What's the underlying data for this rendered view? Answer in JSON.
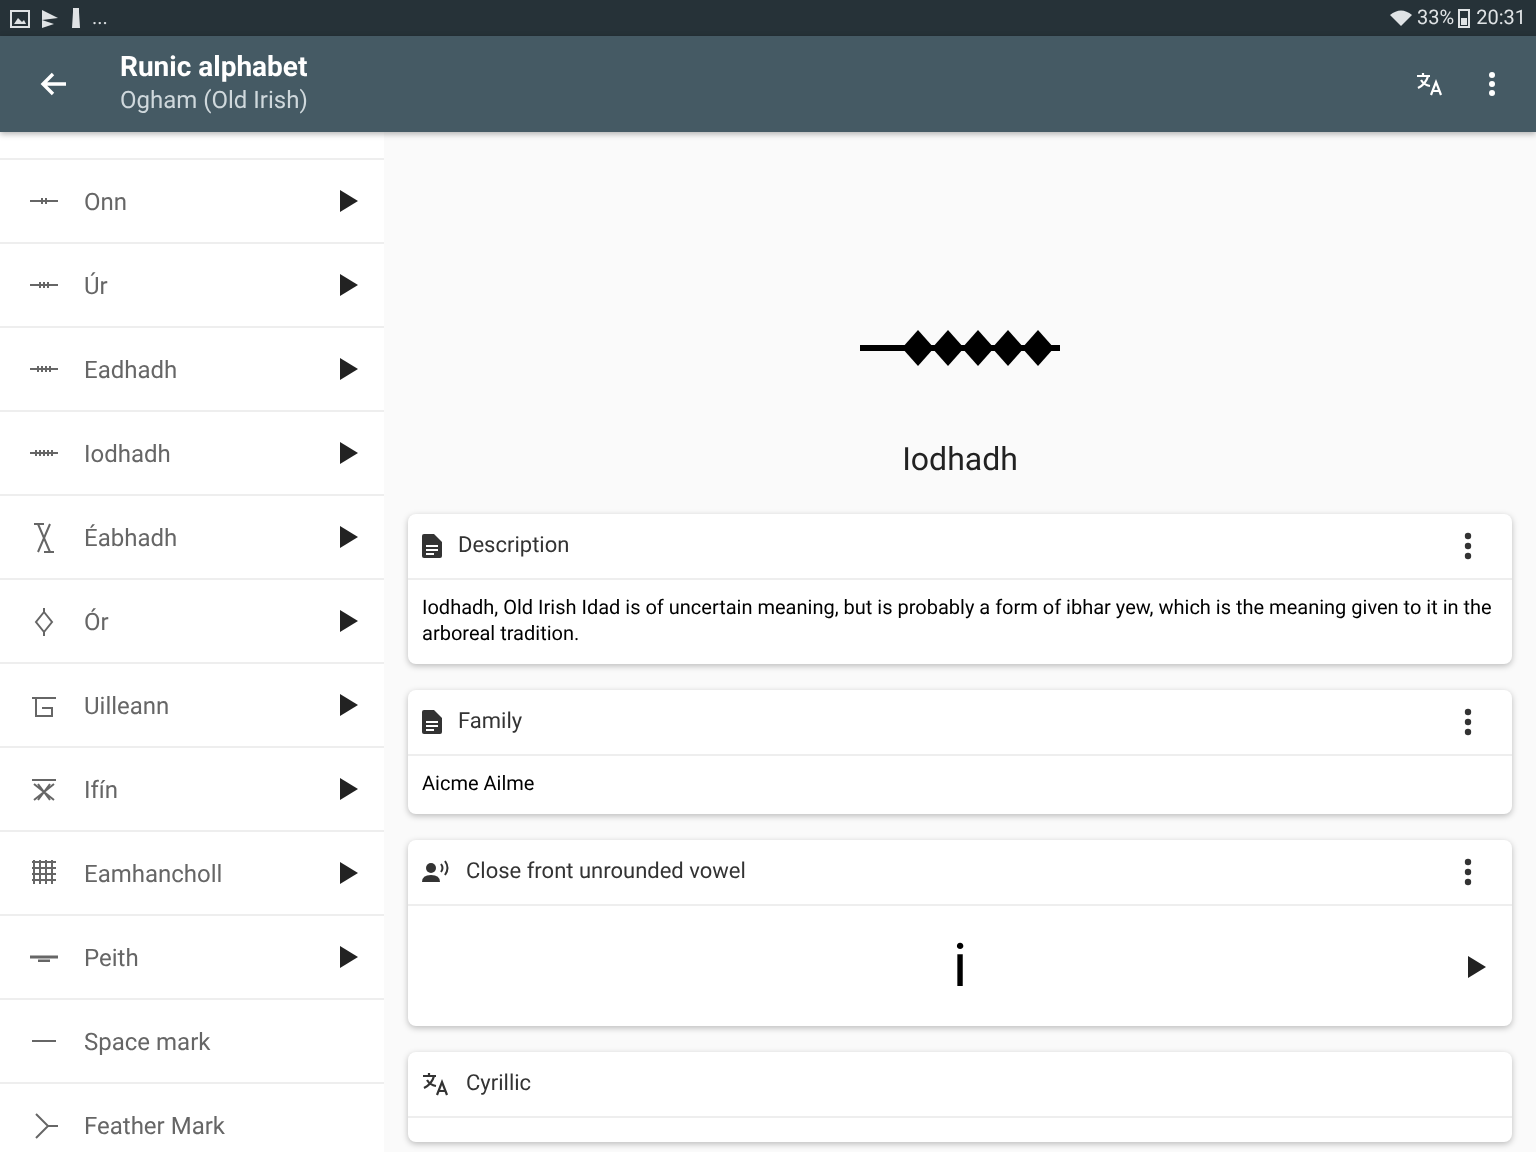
{
  "status_bar": {
    "notifications": "...",
    "battery": "33%",
    "time": "20:31"
  },
  "toolbar": {
    "title": "Runic alphabet",
    "subtitle": "Ogham (Old Irish)"
  },
  "letters": [
    {
      "name": "Onn",
      "expandable": true
    },
    {
      "name": "Úr",
      "expandable": true
    },
    {
      "name": "Eadhadh",
      "expandable": true
    },
    {
      "name": "Iodhadh",
      "expandable": true
    },
    {
      "name": "Éabhadh",
      "expandable": true
    },
    {
      "name": "Ór",
      "expandable": true
    },
    {
      "name": "Uilleann",
      "expandable": true
    },
    {
      "name": "Ifín",
      "expandable": true
    },
    {
      "name": "Eamhancholl",
      "expandable": true
    },
    {
      "name": "Peith",
      "expandable": true
    },
    {
      "name": "Space mark",
      "expandable": false
    },
    {
      "name": "Feather Mark",
      "expandable": false
    }
  ],
  "detail": {
    "name": "Iodhadh",
    "cards": [
      {
        "kind": "text",
        "title": "Description",
        "body": "Iodhadh, Old Irish Idad is of uncertain meaning, but is probably a form of ibhar yew, which is the meaning given to it in the arboreal tradition."
      },
      {
        "kind": "text",
        "title": "Family",
        "body": "Aicme Ailme"
      },
      {
        "kind": "sound",
        "title": "Close front unrounded vowel",
        "body": "i"
      },
      {
        "kind": "translation",
        "title": "Cyrillic"
      }
    ]
  }
}
